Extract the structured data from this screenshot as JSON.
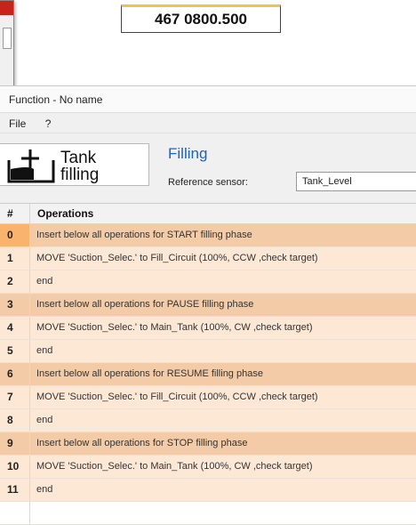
{
  "part_number": "467 0800.500",
  "window": {
    "title": "Function - No name",
    "menu": [
      "File",
      "?"
    ]
  },
  "header": {
    "logo_text_line1": "Tank",
    "logo_text_line2": "filling",
    "section_title": "Filling",
    "reference_label": "Reference sensor:",
    "reference_value": "Tank_Level"
  },
  "grid": {
    "columns": [
      "#",
      "Operations"
    ],
    "rows": [
      {
        "num": "0",
        "text": "Insert below all operations for START filling phase"
      },
      {
        "num": "1",
        "text": "MOVE 'Suction_Selec.' to Fill_Circuit (100%, CCW ,check target)"
      },
      {
        "num": "2",
        "text": "end"
      },
      {
        "num": "3",
        "text": "Insert below all operations for PAUSE filling phase"
      },
      {
        "num": "4",
        "text": "MOVE 'Suction_Selec.' to Main_Tank (100%, CW ,check target)"
      },
      {
        "num": "5",
        "text": "end"
      },
      {
        "num": "6",
        "text": "Insert below all operations for RESUME filling phase"
      },
      {
        "num": "7",
        "text": "MOVE 'Suction_Selec.' to Fill_Circuit (100%, CCW ,check target)"
      },
      {
        "num": "8",
        "text": "end"
      },
      {
        "num": "9",
        "text": "Insert below all operations for STOP filling phase"
      },
      {
        "num": "10",
        "text": "MOVE 'Suction_Selec.' to Main_Tank (100%, CW ,check target)"
      },
      {
        "num": "11",
        "text": "end"
      }
    ]
  },
  "colors": {
    "phase_row": "#f3cba7",
    "op_row": "#fde8d6",
    "title_blue": "#1e63b6",
    "label_border_top": "#e8c64a"
  }
}
